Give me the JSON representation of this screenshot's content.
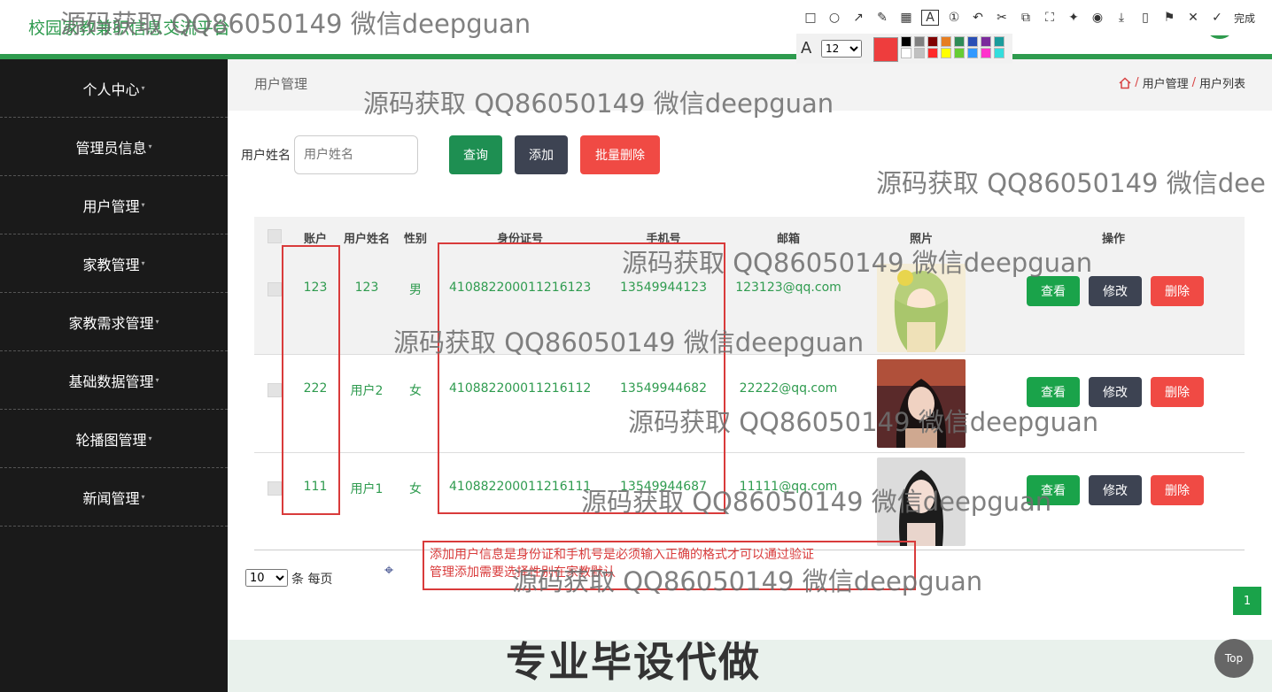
{
  "header": {
    "site_title": "校园家教兼职信息交流平台"
  },
  "sidebar": {
    "items": [
      {
        "label": "个人中心"
      },
      {
        "label": "管理员信息"
      },
      {
        "label": "用户管理"
      },
      {
        "label": "家教管理"
      },
      {
        "label": "家教需求管理"
      },
      {
        "label": "基础数据管理"
      },
      {
        "label": "轮播图管理"
      },
      {
        "label": "新闻管理"
      }
    ]
  },
  "breadcrumb": {
    "page": "用户管理",
    "path_1": "用户管理",
    "path_2": "用户列表",
    "sep": "/"
  },
  "search": {
    "label": "用户姓名",
    "placeholder": "用户姓名"
  },
  "actions": {
    "query": "查询",
    "add": "添加",
    "batch_delete": "批量删除"
  },
  "table": {
    "headers": {
      "account": "账户",
      "name": "用户姓名",
      "gender": "性别",
      "id_number": "身份证号",
      "phone": "手机号",
      "email": "邮箱",
      "photo": "照片",
      "ops": "操作"
    },
    "rows": [
      {
        "account": "123",
        "name": "123",
        "gender": "男",
        "id_number": "410882200011216123",
        "phone": "13549944123",
        "email": "123123@qq.com"
      },
      {
        "account": "222",
        "name": "用户2",
        "gender": "女",
        "id_number": "410882200011216112",
        "phone": "13549944682",
        "email": "22222@qq.com"
      },
      {
        "account": "111",
        "name": "用户1",
        "gender": "女",
        "id_number": "410882200011216111",
        "phone": "13549944687",
        "email": "11111@qq.com"
      }
    ],
    "row_actions": {
      "view": "查看",
      "edit": "修改",
      "delete": "删除"
    }
  },
  "pagination": {
    "page_size": "10",
    "page_size_label": "条 每页",
    "current_page": "1",
    "top_label": "Top"
  },
  "annotation_note": {
    "line1": "添加用户信息是身份证和手机号是必须输入正确的格式才可以通过验证",
    "line2": "管理添加需要选择性别在家教默认"
  },
  "watermark": {
    "text": "源码获取 QQ86050149 微信deepguan",
    "text_cut": "源码获取 QQ86050149 微信dee",
    "big": "专业毕设代做"
  },
  "annotation_tool": {
    "done": "完成",
    "font_size": "12"
  },
  "colors": {
    "primary_green": "#2e9b4e",
    "dark": "#1a1a1a",
    "danger": "#f04a44",
    "slate": "#3d4352",
    "mark_red": "#d93b3b"
  }
}
